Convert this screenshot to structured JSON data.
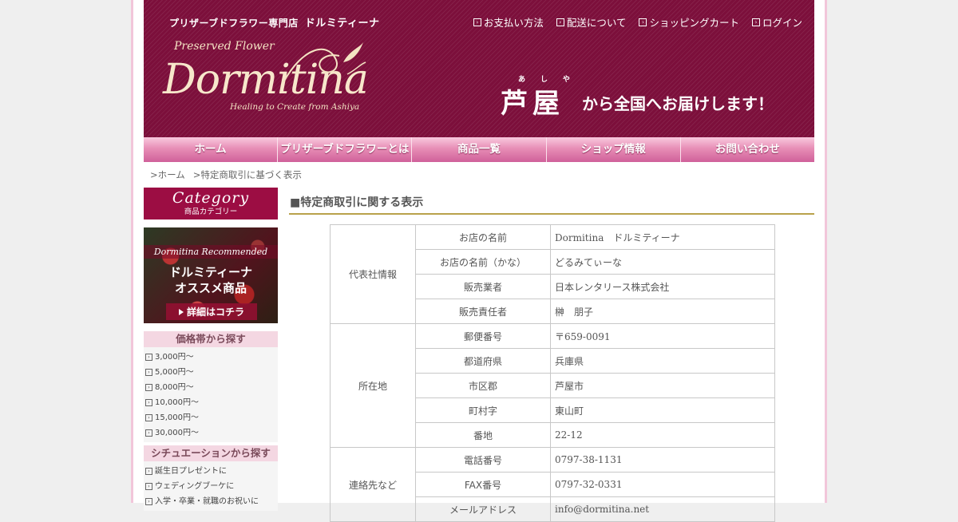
{
  "header": {
    "shop_label": "プリザーブドフラワー専門店",
    "shop_name": "ドルミティーナ",
    "logo": {
      "sub1": "Preserved Flower",
      "word": "Dormitina",
      "sub2": "Healing to Create from Ashiya"
    },
    "top_links": [
      {
        "label": "お支払い方法",
        "icon": "arrow-box-icon"
      },
      {
        "label": "配送について",
        "icon": "arrow-box-icon"
      },
      {
        "label": "ショッピングカート",
        "icon": "arrow-box-icon"
      },
      {
        "label": "ログイン",
        "icon": "arrow-box-icon"
      }
    ],
    "tagline": {
      "ruby": "あしや",
      "big": "芦屋",
      "rest": "から全国へお届けします！"
    }
  },
  "nav": [
    "ホーム",
    "プリザーブドフラワーとは",
    "商品一覧",
    "ショップ情報",
    "お問い合わせ"
  ],
  "breadcrumb": [
    ">ホーム",
    ">特定商取引に基づく表示"
  ],
  "sidebar": {
    "category_en": "Category",
    "category_jp": "商品カテゴリー",
    "recommend": {
      "line1": "Dormitina Recommended",
      "line2": "ドルミティーナ",
      "line3": "オススメ商品",
      "button": "詳細はコチラ"
    },
    "price_title": "価格帯から探す",
    "prices": [
      "3,000円〜",
      "5,000円〜",
      "8,000円〜",
      "10,000円〜",
      "15,000円〜",
      "30,000円〜"
    ],
    "situation_title": "シチュエーションから探す",
    "situations": [
      "誕生日プレゼントに",
      "ウェディングブーケに",
      "入学・卒業・就職のお祝いに"
    ]
  },
  "main": {
    "title": "■特定商取引に関する表示",
    "groups": [
      {
        "name": "代表社情報",
        "rows": [
          {
            "label": "お店の名前",
            "value": "Dormitina　ドルミティーナ"
          },
          {
            "label": "お店の名前（かな）",
            "value": "どるみてぃーな"
          },
          {
            "label": "販売業者",
            "value": "日本レンタリース株式会社"
          },
          {
            "label": "販売責任者",
            "value": "榊　朋子"
          }
        ]
      },
      {
        "name": "所在地",
        "rows": [
          {
            "label": "郵便番号",
            "value": "〒659-0091"
          },
          {
            "label": "都道府県",
            "value": "兵庫県"
          },
          {
            "label": "市区郡",
            "value": "芦屋市"
          },
          {
            "label": "町村字",
            "value": "東山町"
          },
          {
            "label": "番地",
            "value": "22-12"
          }
        ]
      },
      {
        "name": "連絡先など",
        "rows": [
          {
            "label": "電話番号",
            "value": "0797-38-1131"
          },
          {
            "label": "FAX番号",
            "value": "0797-32-0331"
          },
          {
            "label": "メールアドレス",
            "value": "info@dormitina.net"
          }
        ]
      }
    ]
  }
}
